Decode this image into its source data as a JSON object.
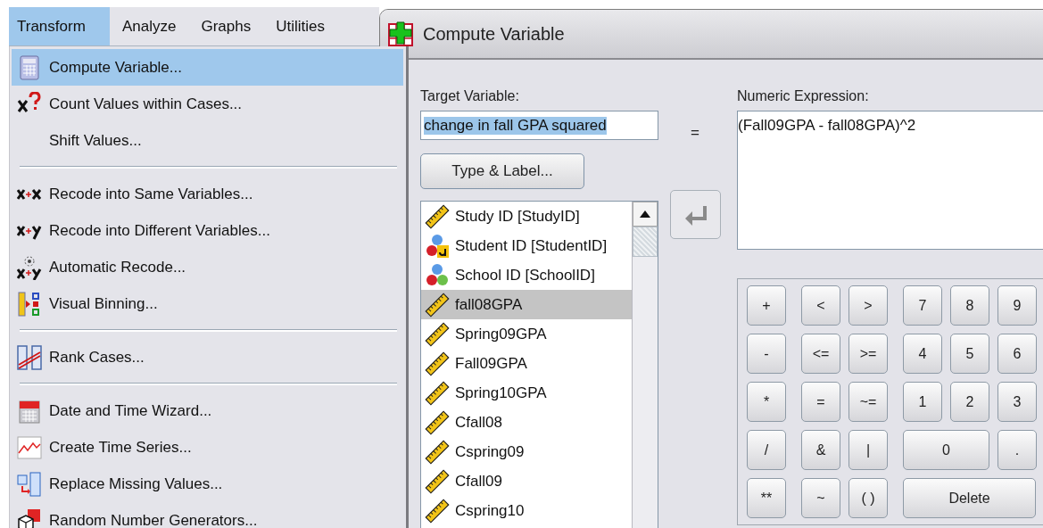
{
  "menubar": [
    {
      "label": "Transform",
      "selected": true
    },
    {
      "label": "Analyze",
      "selected": false
    },
    {
      "label": "Graphs",
      "selected": false
    },
    {
      "label": "Utilities",
      "selected": false
    }
  ],
  "menu": {
    "groups": [
      [
        {
          "label": "Compute Variable...",
          "kind": "calculator",
          "selected": true
        },
        {
          "label": "Count Values within Cases...",
          "kind": "count",
          "selected": false
        },
        {
          "label": "Shift Values...",
          "kind": "plain",
          "selected": false
        }
      ],
      [
        {
          "label": "Recode into Same Variables...",
          "kind": "recode-same",
          "selected": false
        },
        {
          "label": "Recode into Different Variables...",
          "kind": "recode-different",
          "selected": false
        },
        {
          "label": "Automatic Recode...",
          "kind": "auto-recode",
          "selected": false
        },
        {
          "label": "Visual Binning...",
          "kind": "binning",
          "selected": false
        }
      ],
      [
        {
          "label": "Rank Cases...",
          "kind": "rank",
          "selected": false
        }
      ],
      [
        {
          "label": "Date and Time Wizard...",
          "kind": "calendar",
          "selected": false
        },
        {
          "label": "Create Time Series...",
          "kind": "time-series",
          "selected": false
        },
        {
          "label": "Replace Missing Values...",
          "kind": "replace-missing",
          "selected": false
        },
        {
          "label": "Random Number Generators...",
          "kind": "dice",
          "selected": false
        }
      ]
    ]
  },
  "dialog": {
    "title": "Compute Variable",
    "target_label": "Target Variable:",
    "target_value": "change in fall GPA squared",
    "type_label_button": "Type & Label...",
    "equals": "=",
    "expression_label": "Numeric Expression:",
    "expression_value": "(Fall09GPA - fall08GPA)^2",
    "variables": [
      {
        "label": "Study ID [StudyID]",
        "kind": "scale",
        "selected": false
      },
      {
        "label": "Student ID [StudentID]",
        "kind": "nominal-string",
        "selected": false
      },
      {
        "label": "School ID [SchoolID]",
        "kind": "nominal",
        "selected": false
      },
      {
        "label": "fall08GPA",
        "kind": "scale",
        "selected": true
      },
      {
        "label": "Spring09GPA",
        "kind": "scale",
        "selected": false
      },
      {
        "label": "Fall09GPA",
        "kind": "scale",
        "selected": false
      },
      {
        "label": "Spring10GPA",
        "kind": "scale",
        "selected": false
      },
      {
        "label": "Cfall08",
        "kind": "scale",
        "selected": false
      },
      {
        "label": "Cspring09",
        "kind": "scale",
        "selected": false
      },
      {
        "label": "Cfall09",
        "kind": "scale",
        "selected": false
      },
      {
        "label": "Cspring10",
        "kind": "scale",
        "selected": false
      }
    ],
    "keypad": [
      [
        [
          {
            "label": "+",
            "kind": "key"
          }
        ],
        [
          {
            "label": "<",
            "kind": "key"
          },
          {
            "label": ">",
            "kind": "key"
          }
        ],
        [
          {
            "label": "7",
            "kind": "key"
          },
          {
            "label": "8",
            "kind": "key"
          },
          {
            "label": "9",
            "kind": "key"
          }
        ]
      ],
      [
        [
          {
            "label": "-",
            "kind": "key"
          }
        ],
        [
          {
            "label": "<=",
            "kind": "key"
          },
          {
            "label": ">=",
            "kind": "key"
          }
        ],
        [
          {
            "label": "4",
            "kind": "key"
          },
          {
            "label": "5",
            "kind": "key"
          },
          {
            "label": "6",
            "kind": "key"
          }
        ]
      ],
      [
        [
          {
            "label": "*",
            "kind": "key"
          }
        ],
        [
          {
            "label": "=",
            "kind": "key"
          },
          {
            "label": "~=",
            "kind": "key"
          }
        ],
        [
          {
            "label": "1",
            "kind": "key"
          },
          {
            "label": "2",
            "kind": "key"
          },
          {
            "label": "3",
            "kind": "key"
          }
        ]
      ],
      [
        [
          {
            "label": "/",
            "kind": "key"
          }
        ],
        [
          {
            "label": "&",
            "kind": "key"
          },
          {
            "label": "|",
            "kind": "key"
          }
        ],
        [
          {
            "label": "0",
            "kind": "wide"
          },
          {
            "label": ".",
            "kind": "key"
          }
        ]
      ],
      [
        [
          {
            "label": "**",
            "kind": "key"
          }
        ],
        [
          {
            "label": "~",
            "kind": "key"
          },
          {
            "label": "( )",
            "kind": "key"
          }
        ],
        [
          {
            "label": "Delete",
            "kind": "widest"
          }
        ]
      ]
    ]
  }
}
